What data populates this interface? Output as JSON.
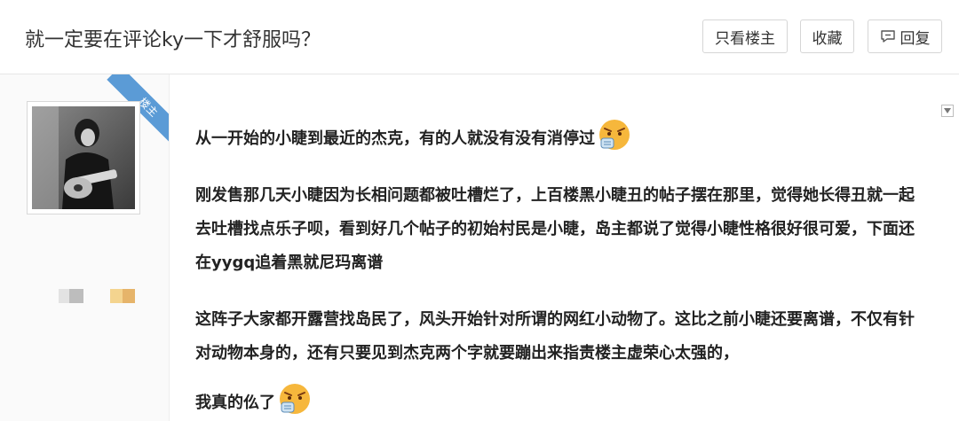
{
  "header": {
    "title": "就一定要在评论ky一下才舒服吗？",
    "buttons": {
      "only_lz": "只看楼主",
      "favorite": "收藏",
      "reply": "回复"
    }
  },
  "author": {
    "badge": "楼主"
  },
  "post": {
    "paragraphs": [
      "从一开始的小睫到最近的杰克，有的人就没有没有消停过",
      "刚发售那几天小睫因为长相问题都被吐槽烂了，上百楼黑小睫丑的帖子摆在那里，觉得她长得丑就一起去吐槽找点乐子呗，看到好几个帖子的初始村民是小睫，岛主都说了觉得小睫性格很好很可爱，下面还在yygq追着黑就尼玛离谱",
      "这阵子大家都开露营找岛民了，风头开始针对所谓的网红小动物了。这比之前小睫还要离谱，不仅有针对动物本身的，还有只要见到杰克两个字就要蹦出来指责楼主虚荣心太强的，",
      "我真的仫了"
    ],
    "emoji_name": "angry-face-emoji"
  },
  "colors": {
    "badge_blue": "#5b9bd6",
    "border": "#d6d6d6"
  }
}
